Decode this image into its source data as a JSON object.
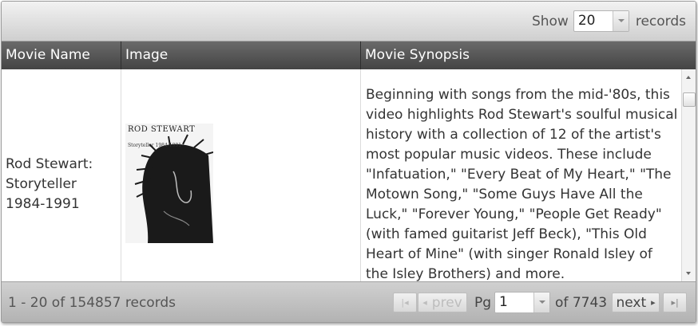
{
  "toolbar": {
    "show_label": "Show",
    "page_size": "20",
    "records_label": "records"
  },
  "columns": [
    "Movie Name",
    "Image",
    "Movie Synopsis"
  ],
  "rows": [
    {
      "movie_name": "Rod Stewart: Storyteller 1984-1991",
      "poster_title": "ROD STEWART",
      "poster_subtitle": "Storyteller 1984-1991",
      "synopsis": "Beginning with songs from the mid-'80s, this video highlights Rod Stewart's soulful musical history with a collection of 12 of the artist's most popular music videos. These include \"Infatuation,\" \"Every Beat of My Heart,\" \"The Motown Song,\" \"Some Guys Have All the Luck,\" \"Forever Young,\" \"People Get Ready\" (with famed guitarist Jeff Beck), \"This Old Heart of Mine\" (with singer Ronald Isley of the Isley Brothers) and more."
    }
  ],
  "footer": {
    "records_info": "1 - 20 of 154857 records",
    "prev_label": "prev",
    "page_label": "Pg",
    "current_page": "1",
    "of_label": "of 7743",
    "next_label": "next"
  },
  "icons": {
    "first": "first-page-icon",
    "prev": "prev-arrow-icon",
    "next": "next-arrow-icon",
    "last": "last-page-icon",
    "dropdown": "chevron-down-icon"
  },
  "colors": {
    "header_bg": "#555555",
    "toolbar_bg": "#e0e0e0"
  }
}
